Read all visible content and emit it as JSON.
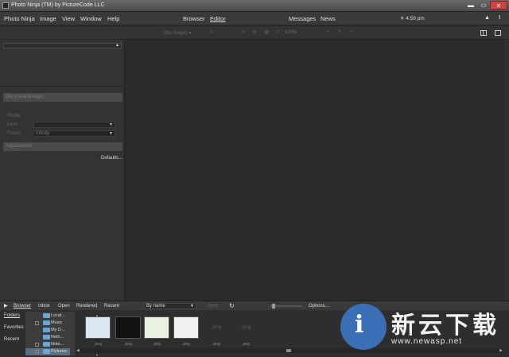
{
  "window": {
    "title": "Photo Ninja (TM) by PictureCode LLC",
    "buttons": {
      "minimize": "▬",
      "maximize": "▭",
      "close": "✕"
    }
  },
  "menubar": {
    "items": [
      "Photo Ninja",
      "Image",
      "View",
      "Window",
      "Help"
    ],
    "modes": [
      "Browser",
      "Editor"
    ],
    "active_mode": "Editor",
    "right_items": [
      "Messages",
      "News"
    ],
    "clock": "4:59 pm",
    "clock_icon": "star-icon"
  },
  "toolbar": {
    "image_select": "(No image)",
    "page": "1",
    "zoom": "100%"
  },
  "left_panel": {
    "section1": "(No preset/image)",
    "profile_label": "Profile",
    "lens_label": "Lens",
    "lens_value": "",
    "focus_label": "Focus",
    "focus_value": "Infinity",
    "section2": "Adjustments",
    "defaults": "Defaults..."
  },
  "browser_bar": {
    "items": [
      "Browser",
      "Inbox",
      "Open",
      "Rendered",
      "Recent"
    ],
    "active": "Browser",
    "sort": "By name",
    "sync": "Sync",
    "options": "Options..."
  },
  "side_tabs": [
    "Folders",
    "Favorites",
    "Recent"
  ],
  "folder_tree": [
    {
      "label": "Local...",
      "expander": false,
      "selected": false
    },
    {
      "label": "Music",
      "expander": true,
      "selected": false
    },
    {
      "label": "My D...",
      "expander": false,
      "selected": false
    },
    {
      "label": "Neth...",
      "expander": false,
      "selected": false
    },
    {
      "label": "Note...",
      "expander": true,
      "selected": false
    },
    {
      "label": "Pictures",
      "expander": true,
      "selected": true
    }
  ],
  "thumbnails": [
    {
      "caption": ".png",
      "style": "blue",
      "placeholder": ""
    },
    {
      "caption": ".png",
      "style": "black",
      "placeholder": ""
    },
    {
      "caption": ".png",
      "style": "green",
      "placeholder": ""
    },
    {
      "caption": ".png",
      "style": "white",
      "placeholder": ""
    },
    {
      "caption": ".png",
      "style": "empty",
      "placeholder": ".png"
    },
    {
      "caption": ".png",
      "style": "empty",
      "placeholder": ".png"
    }
  ],
  "watermark": {
    "logo_glyph": "i",
    "text": "新云下载",
    "url": "www.newasp.net"
  },
  "colors": {
    "accent": "#3a6fb6",
    "selection": "#5a6e84",
    "folder": "#6aa7d8"
  }
}
